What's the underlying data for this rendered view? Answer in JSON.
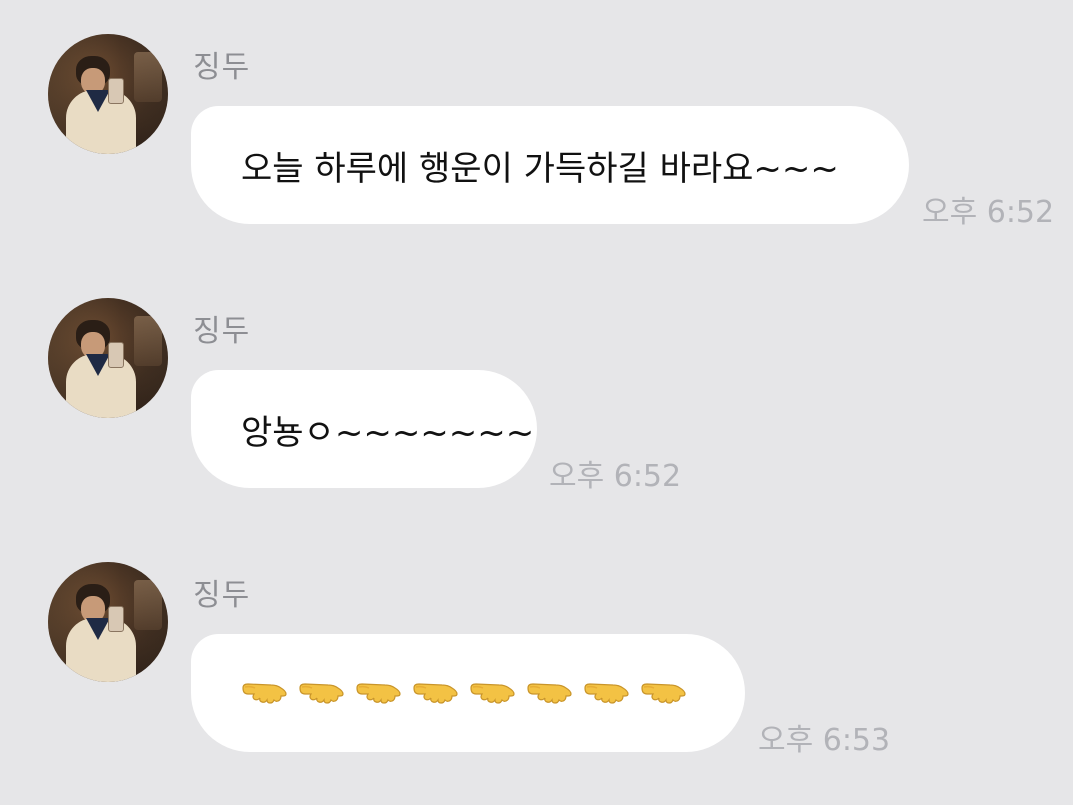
{
  "messages": [
    {
      "sender": "징두",
      "text": "오늘 하루에 행운이 가득하길 바라요~~~",
      "time": "오후 6:52"
    },
    {
      "sender": "징두",
      "text": "앙뇽ㅇ~~~~~~~",
      "time": "오후 6:52"
    },
    {
      "sender": "징두",
      "emoji_count": 8,
      "emoji_name": "palm-down-hand-icon",
      "time": "오후 6:53"
    }
  ],
  "colors": {
    "background": "#e6e6e8",
    "bubble": "#ffffff",
    "sender_name": "#8d8e93",
    "timestamp": "#b2b3b8",
    "emoji": "#f3c244"
  }
}
